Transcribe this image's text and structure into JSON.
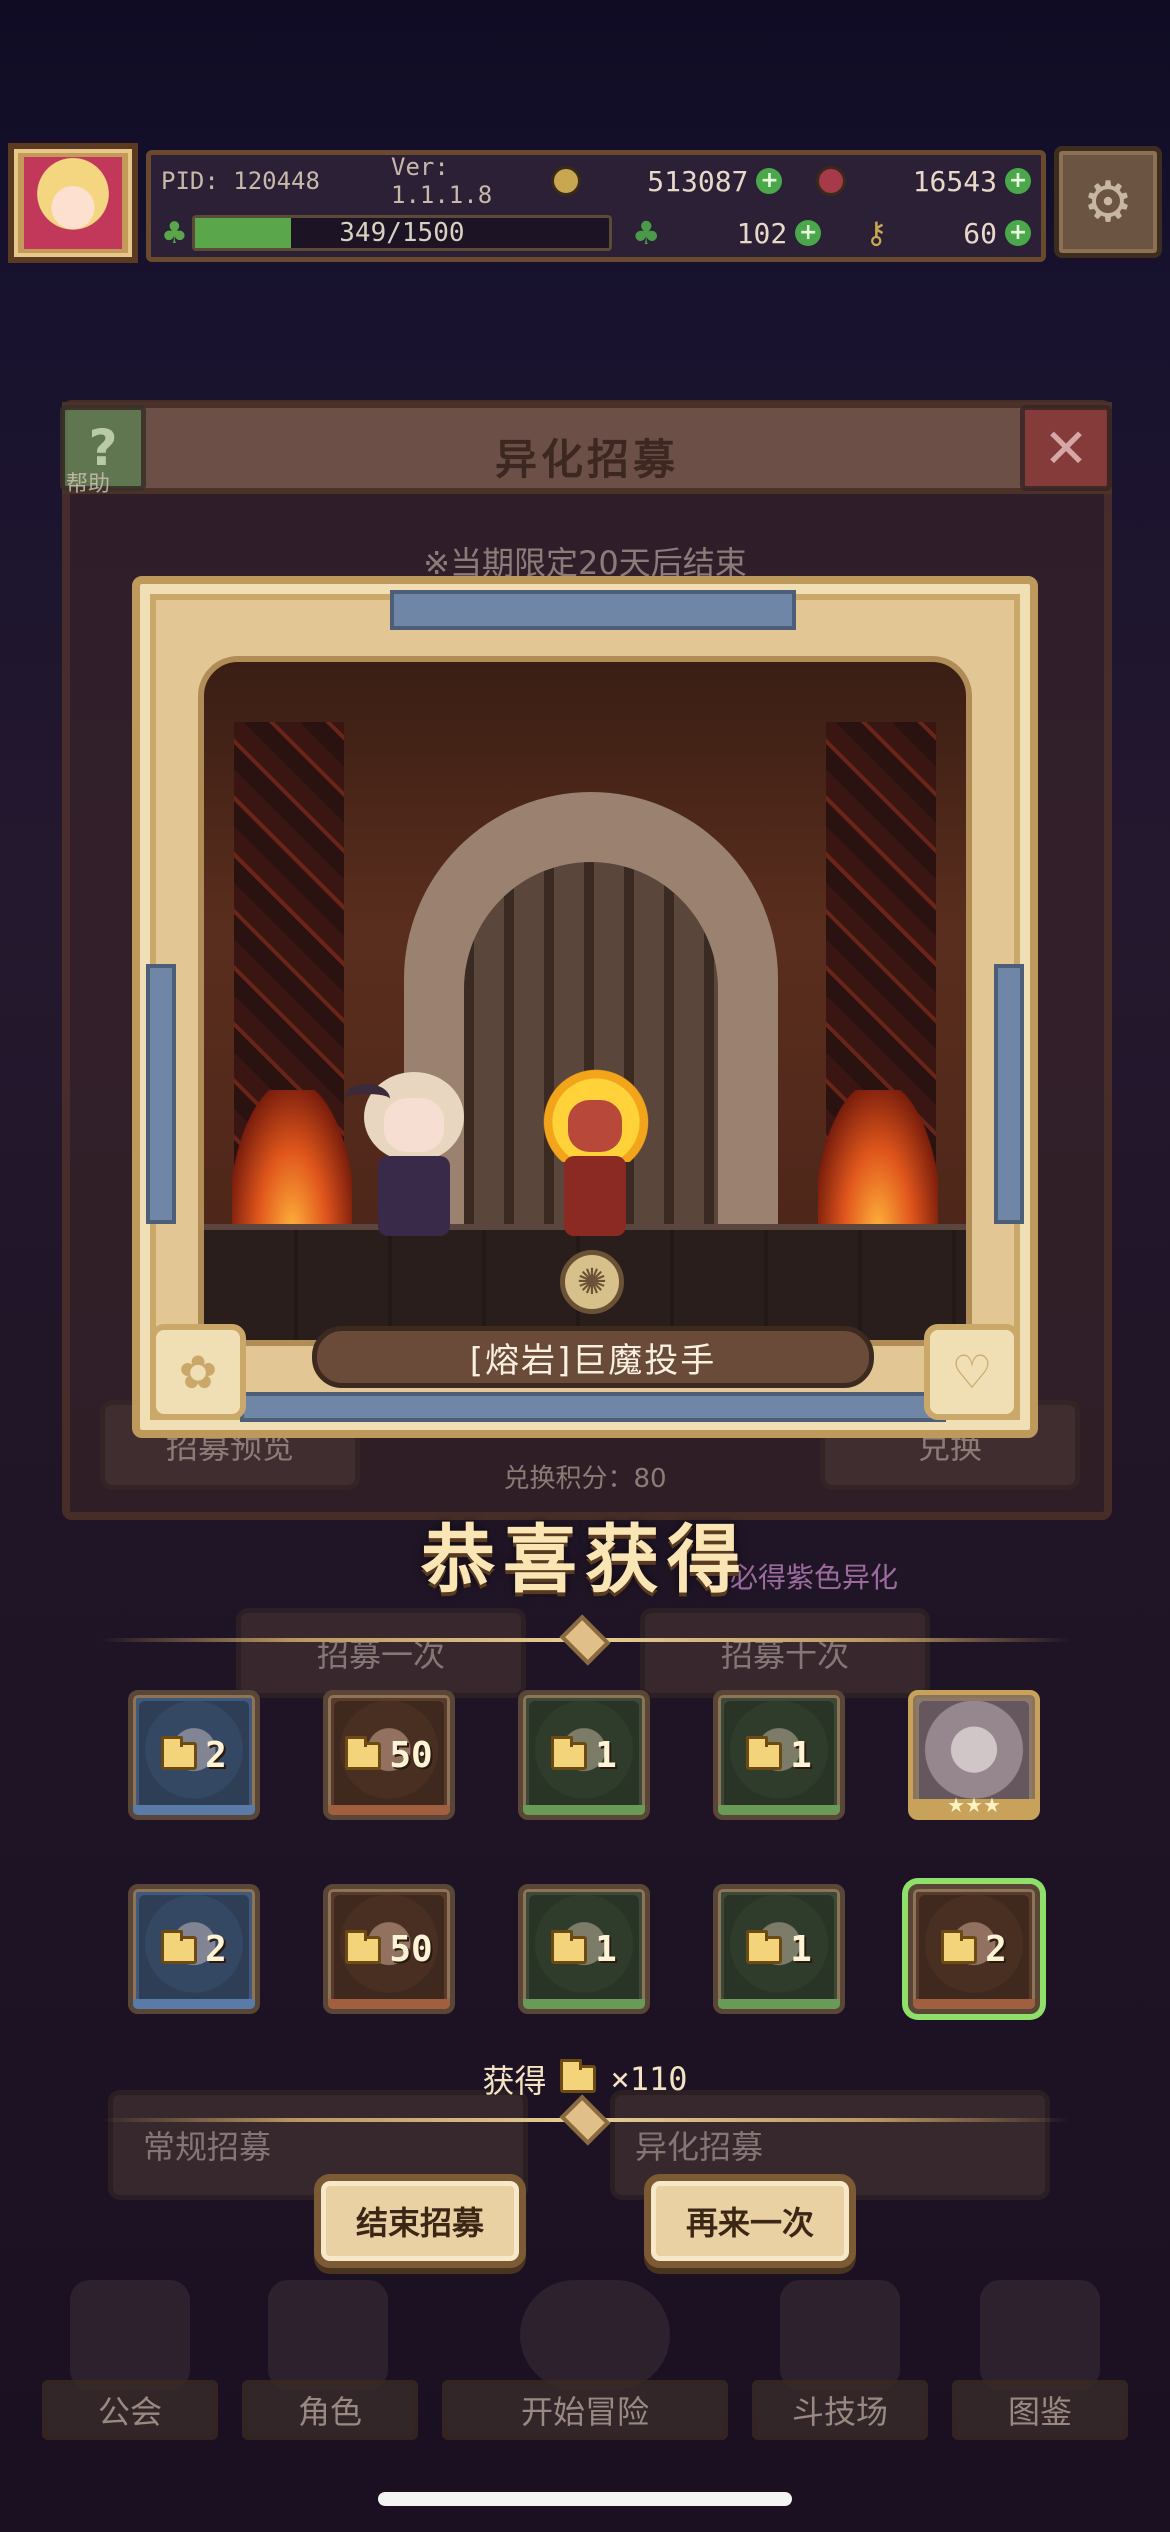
{
  "hud": {
    "pid": "PID: 120448",
    "version": "Ver: 1.1.1.8",
    "gold": "513087",
    "gems": "16543",
    "xp_text": "349/1500",
    "xp_fraction": 0.2327,
    "clover": "102",
    "keys": "60"
  },
  "dialog": {
    "title": "异化招募",
    "help_label": "帮助",
    "notice": "※当期限定20天后结束",
    "exchange_points": "兑换积分：80"
  },
  "background": {
    "left_preview": "招募预览",
    "right_exchange": "兑换",
    "once": "招募一次",
    "ten": "招募十次",
    "purple_hint": "必得紫色异化",
    "normal_recruit": "常规招募",
    "alien_recruit": "异化招募"
  },
  "featured": {
    "name": "[熔岩]巨魔投手"
  },
  "congrats": "恭喜获得",
  "rewards": [
    {
      "qty": "2",
      "style": "blue"
    },
    {
      "qty": "50",
      "style": "brown"
    },
    {
      "qty": "1",
      "style": "green"
    },
    {
      "qty": "1",
      "style": "green"
    },
    {
      "qty": "",
      "style": "gold",
      "stars": "★★★"
    },
    {
      "qty": "2",
      "style": "blue"
    },
    {
      "qty": "50",
      "style": "brown"
    },
    {
      "qty": "1",
      "style": "green"
    },
    {
      "qty": "1",
      "style": "green"
    },
    {
      "qty": "2",
      "style": "brown",
      "selected": true
    }
  ],
  "obtain": {
    "label": "获得",
    "times": "×110"
  },
  "buttons": {
    "end": "结束招募",
    "again": "再来一次"
  },
  "nav": [
    "公会",
    "角色",
    "开始冒险",
    "斗技场",
    "图鉴"
  ],
  "colors": {
    "accent_gold": "#e9d1a4",
    "title_cream": "#f9e6b4",
    "selected_glow": "#8fe06a"
  }
}
